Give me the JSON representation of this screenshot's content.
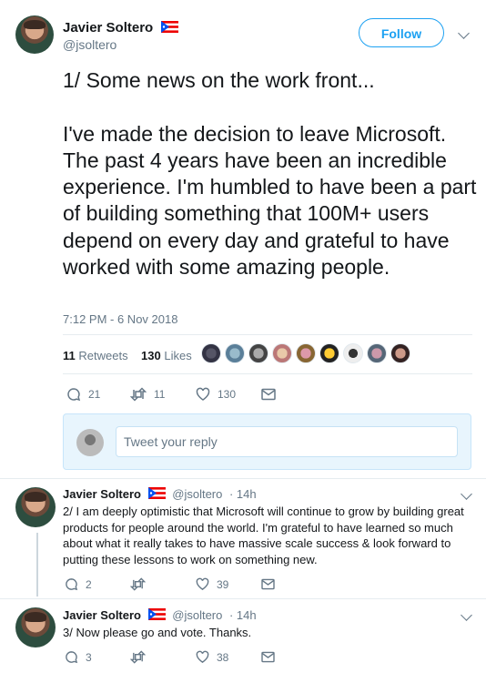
{
  "main_tweet": {
    "author": "Javier Soltero",
    "handle": "@jsoltero",
    "follow_label": "Follow",
    "text": "1/ Some news on the work front...\n\nI've made the decision to leave Microsoft. The past 4 years have been an incredible experience. I'm humbled to have been a part of building something that 100M+ users depend on every day and grateful to have worked with some amazing people.",
    "timestamp": "7:12 PM - 6 Nov 2018",
    "retweets_count": "11",
    "retweets_label": "Retweets",
    "likes_count": "130",
    "likes_label": "Likes",
    "actions": {
      "replies": "21",
      "retweets": "11",
      "likes": "130"
    }
  },
  "reply_box": {
    "placeholder": "Tweet your reply"
  },
  "thread": [
    {
      "author": "Javier Soltero",
      "handle": "@jsoltero",
      "time": "· 14h",
      "text": "2/ I am deeply optimistic that Microsoft will continue to grow by building great products for people around the world. I'm grateful to have learned so much about what it really takes to have massive scale success & look forward to putting these lessons to work on something new.",
      "actions": {
        "replies": "2",
        "retweets": "",
        "likes": "39"
      }
    },
    {
      "author": "Javier Soltero",
      "handle": "@jsoltero",
      "time": "· 14h",
      "text": "3/ Now please go and vote. Thanks.",
      "actions": {
        "replies": "3",
        "retweets": "",
        "likes": "38"
      }
    }
  ],
  "colors": {
    "accent": "#1da1f2",
    "muted": "#657786",
    "text": "#14171a",
    "reply_box_bg": "#e8f5fd"
  }
}
